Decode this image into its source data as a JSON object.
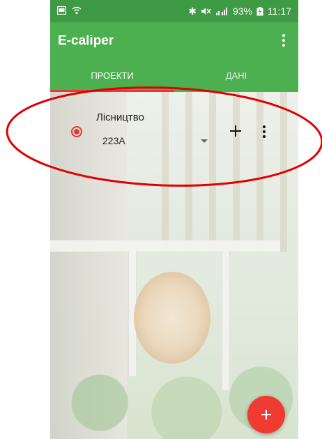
{
  "status_bar": {
    "left_icons": [
      "image-icon",
      "wifi-icon"
    ],
    "bluetooth": "✱",
    "battery_percent": "93%",
    "time": "11:17",
    "colors": {
      "background": "#3e9a45"
    }
  },
  "app_bar": {
    "title": "E-caliper",
    "overflow_icon": "more-vert-icon",
    "color": "#4caf50"
  },
  "tabs": [
    {
      "label": "ПРОЕКТИ",
      "selected": true
    },
    {
      "label": "ДАНІ",
      "selected": false
    }
  ],
  "tab_indicator_color": "#e53935",
  "project": {
    "name": "Лісництво",
    "selected_value": "223А",
    "radio_selected": true,
    "add_icon": "add-icon",
    "overflow_icon": "more-vert-icon"
  },
  "fab": {
    "icon": "add-icon",
    "color": "#ef3b32"
  },
  "annotation": {
    "shape": "ellipse",
    "color": "#e00000"
  }
}
